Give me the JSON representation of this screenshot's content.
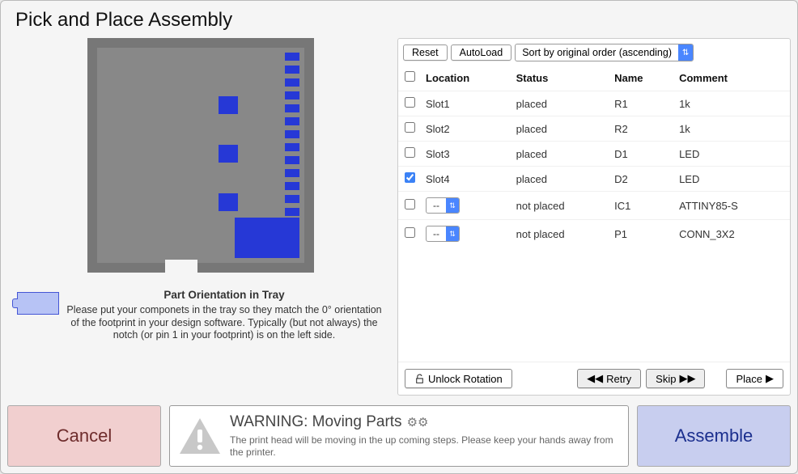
{
  "window": {
    "title": "Pick and Place Assembly"
  },
  "toolbar": {
    "reset": "Reset",
    "autoload": "AutoLoad",
    "sort": "Sort by original order (ascending)"
  },
  "table": {
    "headers": {
      "location": "Location",
      "status": "Status",
      "name": "Name",
      "comment": "Comment"
    },
    "rows": [
      {
        "checked": false,
        "location": "Slot1",
        "status": "placed",
        "name": "R1",
        "comment": "1k",
        "select": false
      },
      {
        "checked": false,
        "location": "Slot2",
        "status": "placed",
        "name": "R2",
        "comment": "1k",
        "select": false
      },
      {
        "checked": false,
        "location": "Slot3",
        "status": "placed",
        "name": "D1",
        "comment": "LED",
        "select": false
      },
      {
        "checked": true,
        "location": "Slot4",
        "status": "placed",
        "name": "D2",
        "comment": "LED",
        "select": false
      },
      {
        "checked": false,
        "location": "--",
        "status": "not placed",
        "name": "IC1",
        "comment": "ATTINY85-S",
        "select": true
      },
      {
        "checked": false,
        "location": "--",
        "status": "not placed",
        "name": "P1",
        "comment": "CONN_3X2",
        "select": true
      }
    ]
  },
  "actions": {
    "unlock": "Unlock Rotation",
    "retry": "Retry",
    "skip": "Skip",
    "place": "Place"
  },
  "orientation": {
    "heading": "Part Orientation in Tray",
    "body": "Please put your componets in the tray so they match the 0° orientation of the footprint in your design software. Typically (but not always) the notch (or pin 1 in your footprint) is on the left side."
  },
  "warning": {
    "heading": "WARNING: Moving Parts",
    "body": "The print head will be moving in the up coming steps. Please keep your hands away from the printer."
  },
  "footer": {
    "cancel": "Cancel",
    "assemble": "Assemble"
  },
  "icons": {
    "unlock": "unlock-icon",
    "retry_left": "⏮",
    "skip_right": "⏭",
    "place_right": "▶",
    "sort_arrows": "⇅",
    "gears": "⚙︎⚙︎"
  }
}
